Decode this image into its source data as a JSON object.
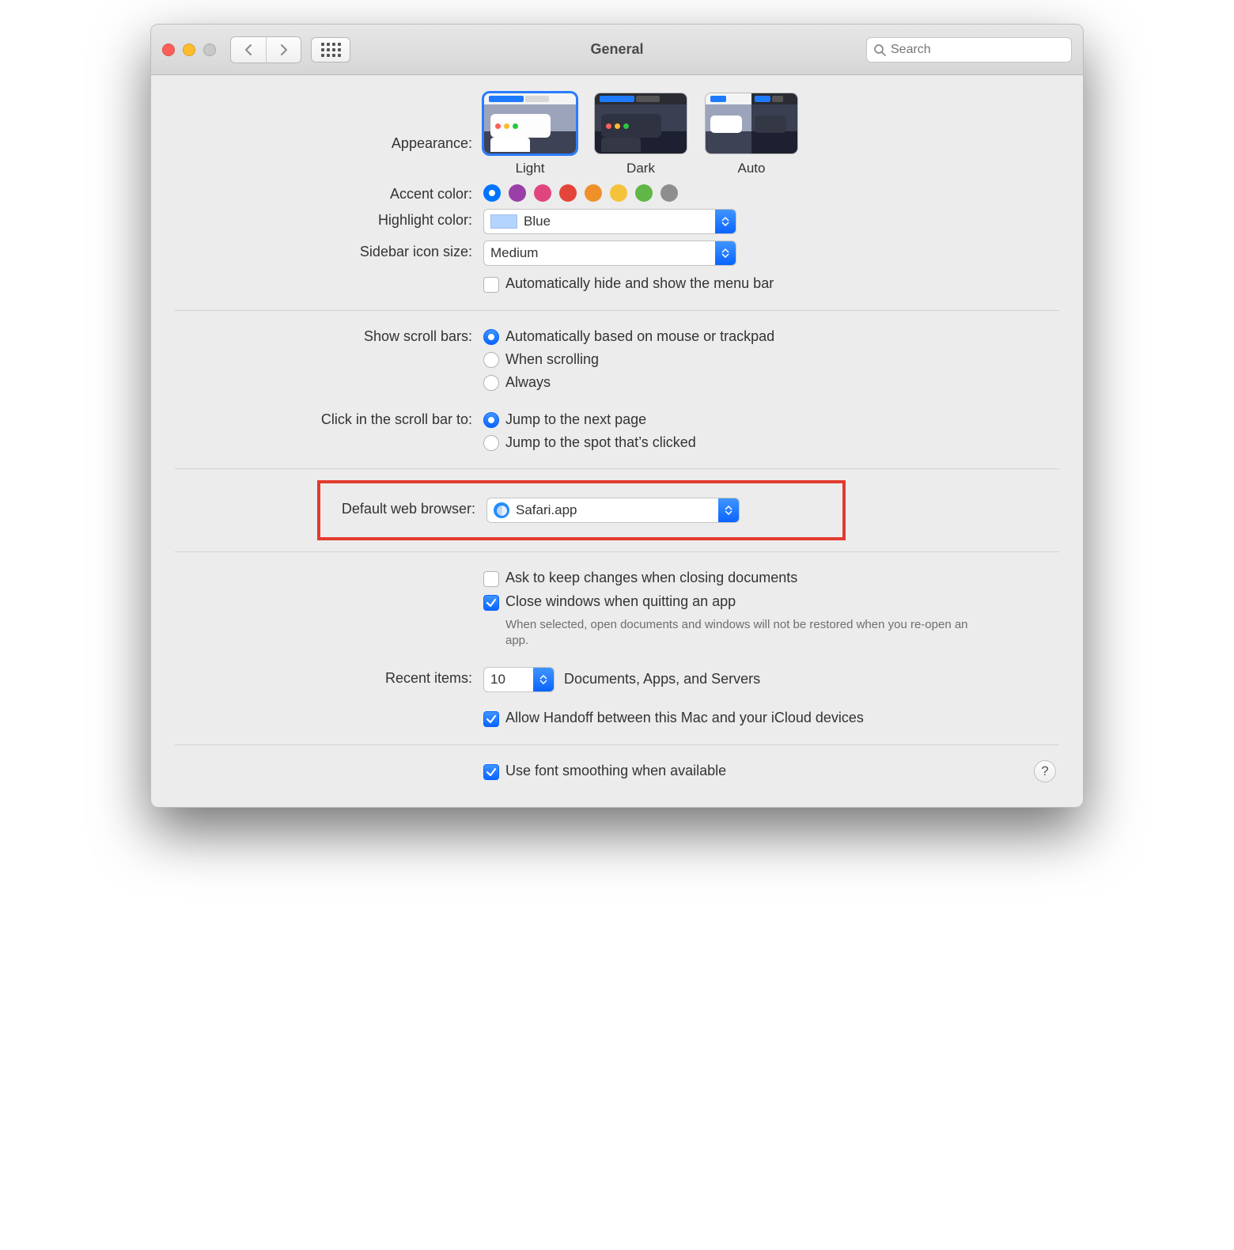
{
  "title": "General",
  "search": {
    "placeholder": "Search"
  },
  "appearance": {
    "label": "Appearance:",
    "options": [
      "Light",
      "Dark",
      "Auto"
    ],
    "selected": "Light"
  },
  "accent": {
    "label": "Accent color:",
    "colors": [
      "#0074ff",
      "#9a3ea8",
      "#e0457d",
      "#e4453a",
      "#f0902a",
      "#f5c33b",
      "#60b646",
      "#8e8e8e"
    ],
    "selected_index": 0
  },
  "highlight": {
    "label": "Highlight color:",
    "value": "Blue"
  },
  "sidebar": {
    "label": "Sidebar icon size:",
    "value": "Medium"
  },
  "autohide_menu": {
    "label": "Automatically hide and show the menu bar",
    "checked": false
  },
  "scrollbars": {
    "label": "Show scroll bars:",
    "options": [
      "Automatically based on mouse or trackpad",
      "When scrolling",
      "Always"
    ],
    "selected_index": 0
  },
  "click_scroll": {
    "label": "Click in the scroll bar to:",
    "options": [
      "Jump to the next page",
      "Jump to the spot that’s clicked"
    ],
    "selected_index": 0
  },
  "default_browser": {
    "label": "Default web browser:",
    "value": "Safari.app"
  },
  "ask_keep": {
    "label": "Ask to keep changes when closing documents",
    "checked": false
  },
  "close_windows": {
    "label": "Close windows when quitting an app",
    "checked": true,
    "hint": "When selected, open documents and windows will not be restored when you re-open an app."
  },
  "recent": {
    "label": "Recent items:",
    "value": "10",
    "suffix": "Documents, Apps, and Servers"
  },
  "handoff": {
    "label": "Allow Handoff between this Mac and your iCloud devices",
    "checked": true
  },
  "font_smoothing": {
    "label": "Use font smoothing when available",
    "checked": true
  },
  "help": "?"
}
